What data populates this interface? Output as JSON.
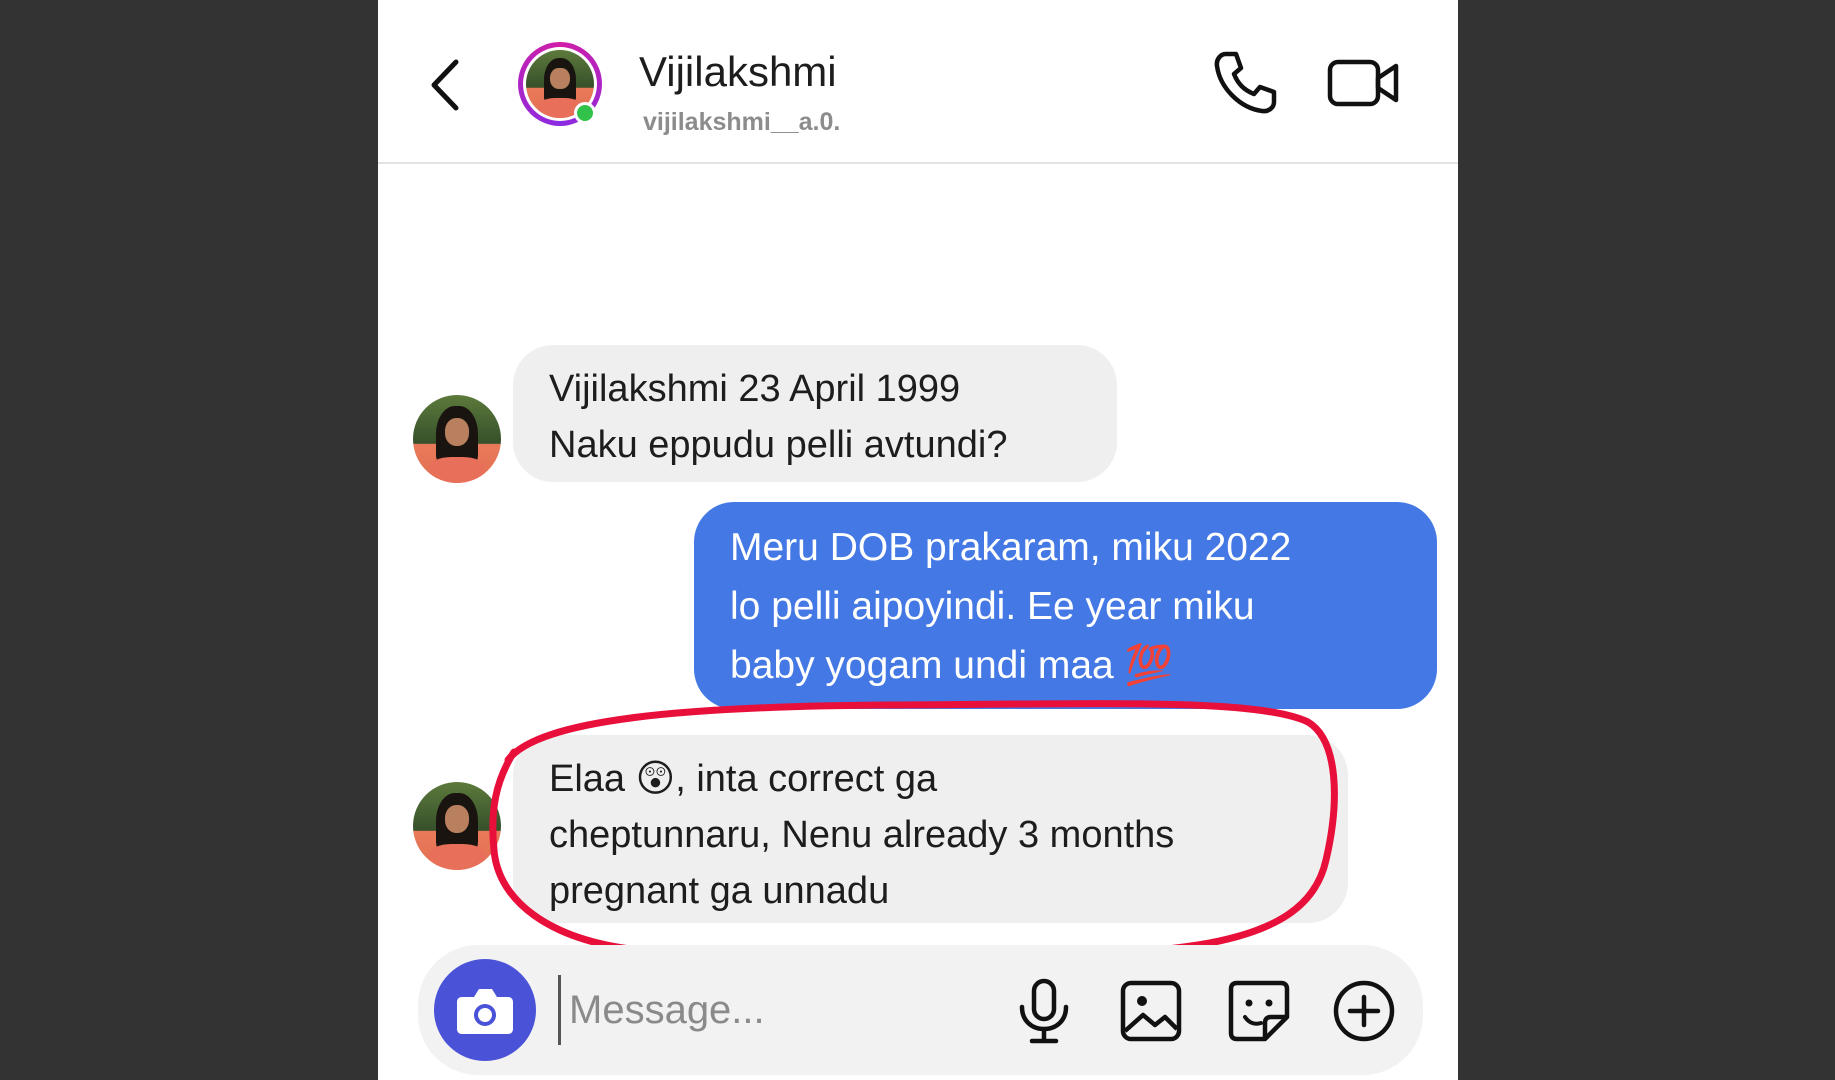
{
  "header": {
    "contact_name": "Vijilakshmi",
    "contact_username": "vijilakshmi__a.0.",
    "online": true,
    "icons": {
      "back": "chevron-left-icon",
      "call": "phone-icon",
      "video": "video-camera-icon"
    }
  },
  "messages": [
    {
      "direction": "incoming",
      "lines": [
        "Vijilakshmi 23 April 1999",
        "Naku eppudu pelli avtundi?"
      ]
    },
    {
      "direction": "outgoing",
      "lines": [
        "Meru DOB prakaram, miku 2022",
        "lo pelli aipoyindi. Ee year miku",
        "baby yogam undi maa 💯"
      ]
    },
    {
      "direction": "incoming",
      "highlighted": true,
      "lines": [
        "Elaa 😲, inta correct ga",
        "cheptunnaru, Nenu already 3 months",
        "pregnant ga unnadu"
      ]
    }
  ],
  "composer": {
    "placeholder": "Message...",
    "icons": [
      "camera-icon",
      "microphone-icon",
      "image-icon",
      "sticker-icon",
      "plus-circle-icon"
    ]
  },
  "colors": {
    "outgoing_bubble": "#4478e4",
    "incoming_bubble": "#efefef",
    "highlight_ring": "#e8103a",
    "camera_button": "#4a52d8",
    "online_dot": "#31c24a"
  }
}
